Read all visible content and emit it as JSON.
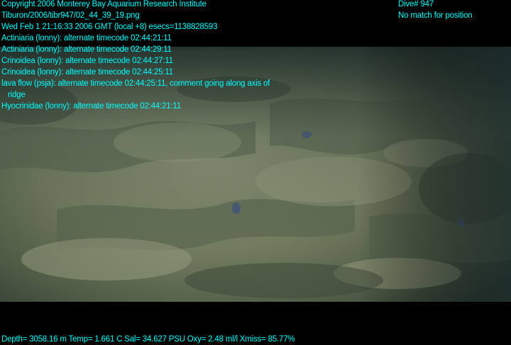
{
  "header": {
    "copyright": "Copyright 2006 Monterey Bay Aquarium Research Institute",
    "file_path": "Tiburon/2006/tibr947/02_44_39_19.png",
    "timestamp": "Wed Feb  1 21:16:33 2006 GMT (local +8)  esecs=1138828593",
    "dive": "Dive# 947",
    "position_status": "No match for position"
  },
  "annotations": [
    "Actiniaria (lonny): alternate timecode 02:44:21:11",
    "Actiniaria (lonny): alternate timecode 02:44:29:11",
    "Crinoidea (lonny): alternate timecode 02:44:27:11",
    "Crinoidea (lonny): alternate timecode 02:44:25:11",
    "lava flow (psja): alternate timecode 02:44:25:11, comment going along axis of",
    "   ridge",
    "Hyocrinidae (lonny): alternate timecode 02:44:21:11"
  ],
  "footer": {
    "telemetry": "Depth= 3058.16 m  Temp= 1.661 C  Sal= 34.627 PSU  Oxy= 2.48 ml/l  Xmiss= 85.77%"
  },
  "colors": {
    "overlay_text": "#00ffff",
    "background": "#000000",
    "seafloor": "#7f8a6a"
  }
}
